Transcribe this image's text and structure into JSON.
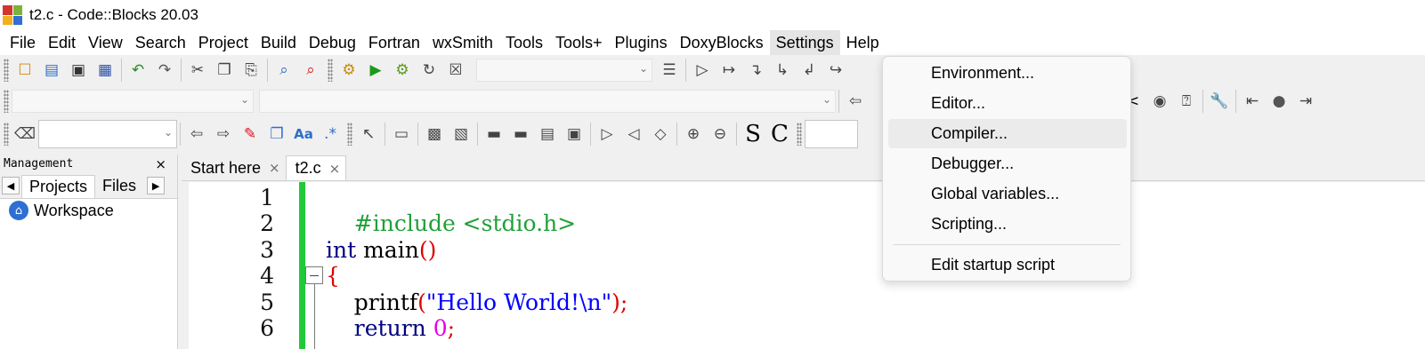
{
  "window": {
    "title": "t2.c - Code::Blocks 20.03"
  },
  "menubar": {
    "items": [
      "File",
      "Edit",
      "View",
      "Search",
      "Project",
      "Build",
      "Debug",
      "Fortran",
      "wxSmith",
      "Tools",
      "Tools+",
      "Plugins",
      "DoxyBlocks",
      "Settings",
      "Help"
    ],
    "active": "Settings"
  },
  "toolbar": {
    "icons": [
      "new-file-icon",
      "open-icon",
      "save-icon",
      "save-all-icon",
      "undo-icon",
      "redo-icon",
      "cut-icon",
      "copy-icon",
      "paste-icon",
      "find-icon",
      "replace-icon",
      "build-icon",
      "run-icon",
      "build-and-run-icon",
      "rebuild-icon",
      "abort-icon"
    ],
    "format_labels": {
      "bold": "S",
      "code": "C",
      "regex": ".*",
      "match_case": "Aa"
    }
  },
  "management": {
    "title": "Management",
    "close": "×",
    "tabs": [
      "Projects",
      "Files"
    ],
    "active_tab": "Projects",
    "tree": [
      "Workspace"
    ]
  },
  "editor": {
    "tabs": [
      {
        "label": "Start here",
        "active": false
      },
      {
        "label": "t2.c",
        "active": true
      }
    ],
    "close_glyph": "×",
    "line_numbers": [
      "1",
      "2",
      "3",
      "4",
      "5",
      "6"
    ],
    "lines": {
      "l1": "#include <stdio.h>",
      "l3_kw": "int",
      "l3_rest": " main",
      "l3_paren": "()",
      "l4": "{",
      "l5_indent": "    ",
      "l5_fn": "printf",
      "l5_open": "(",
      "l5_str": "\"Hello World!\\n\"",
      "l5_close": ");",
      "l6_indent": "    ",
      "l6_kw": "return",
      "l6_num": " 0",
      "l6_semi": ";"
    }
  },
  "settings_menu": {
    "items": [
      "Environment...",
      "Editor...",
      "Compiler...",
      "Debugger...",
      "Global variables...",
      "Scripting..."
    ],
    "hovered": "Compiler...",
    "footer_item": "Edit startup script"
  },
  "colors": {
    "changebar": "#21c93a",
    "keyword": "#000080",
    "preprocessor": "#21a03a",
    "string": "#0000ff",
    "number": "#e600e6",
    "operator": "#e00000"
  }
}
